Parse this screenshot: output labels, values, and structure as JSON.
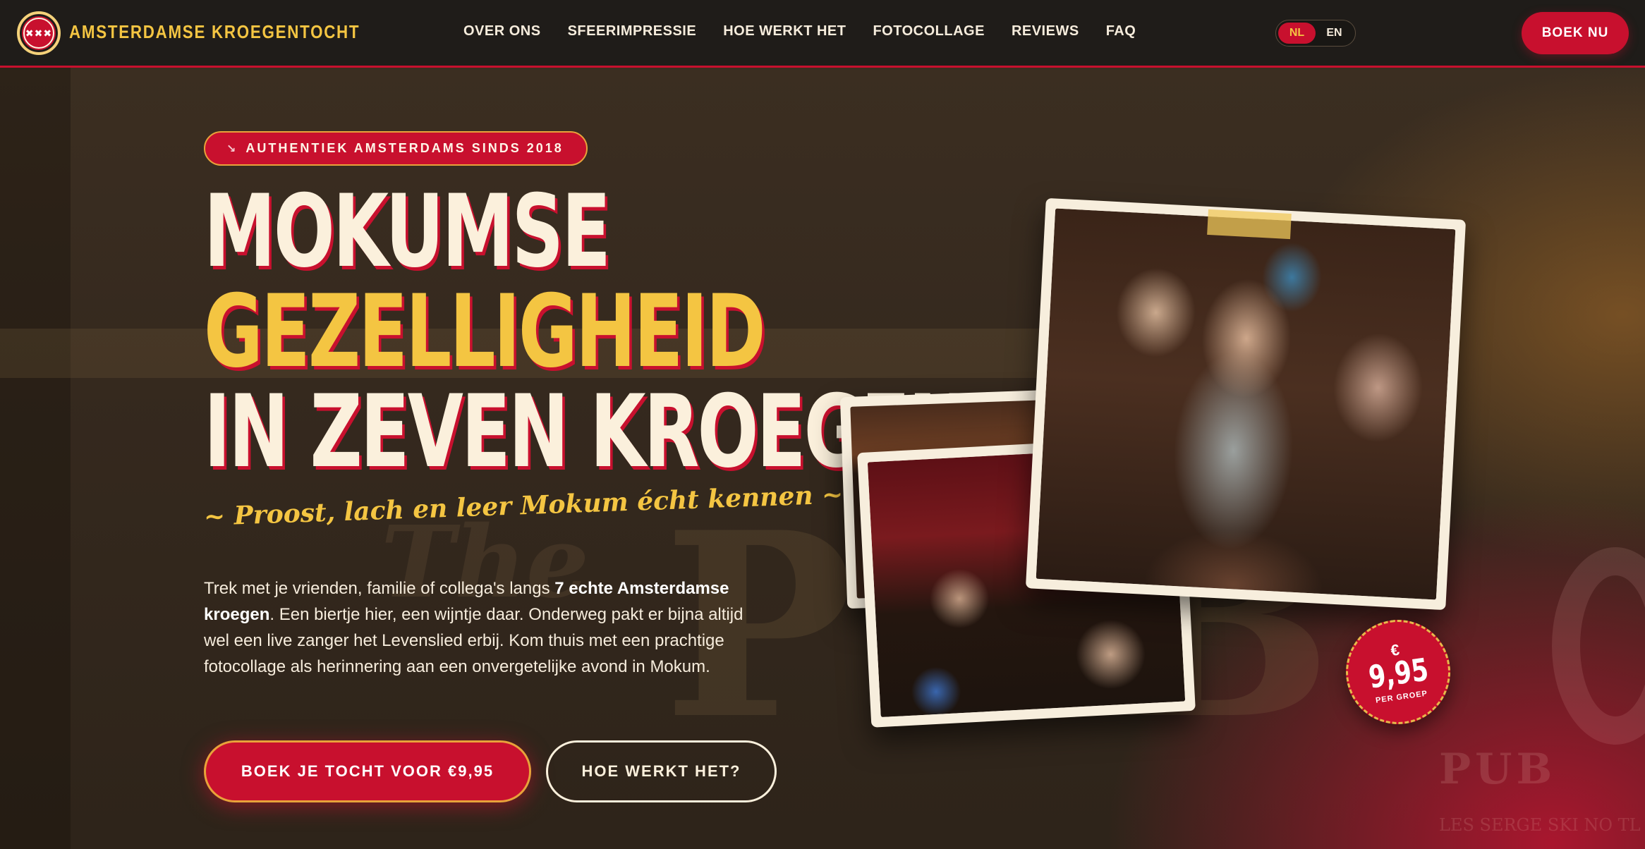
{
  "brand": {
    "logo_mark": "✖✖✖",
    "name": "AMSTERDAMSE KROEGENTOCHT"
  },
  "nav": {
    "items": [
      {
        "label": "OVER ONS"
      },
      {
        "label": "SFEERIMPRESSIE"
      },
      {
        "label": "HOE WERKT HET"
      },
      {
        "label": "FOTOCOLLAGE"
      },
      {
        "label": "REVIEWS"
      },
      {
        "label": "FAQ"
      }
    ],
    "languages": [
      {
        "label": "NL",
        "active": true
      },
      {
        "label": "EN",
        "active": false
      }
    ],
    "cta_label": "BOEK NU"
  },
  "hero": {
    "badge": {
      "icon": "beer-icon",
      "label": "AUTHENTIEK AMSTERDAMS SINDS 2018"
    },
    "headline": {
      "line1": "MOKUMSE",
      "line2": "GEZELLIGHEID",
      "line3": "IN ZEVEN KROEGEN"
    },
    "tagline": "~ Proost, lach en leer Mokum écht kennen ~",
    "intro": {
      "part1": "Trek met je vrienden, familie of collega's langs ",
      "bold1": "7 echte Amsterdamse kroegen",
      "part2": ". Een biertje hier, een wijntje daar. Onderweg pakt er bijna altijd wel een live zanger het Levenslied erbij. Kom thuis met een prachtige fotocollage als herinnering aan een onvergetelijke avond in Mokum."
    },
    "primary_cta": "BOEK JE TOCHT VOOR €9,95",
    "secondary_cta": "HOE WERKT HET?"
  },
  "price_stamp": {
    "currency": "€",
    "amount": "9,95",
    "per": "PER GROEP"
  },
  "background": {
    "sign_text": "PUB",
    "sign_prefix": "The",
    "corner_sign": "PUB",
    "corner_sub": "LES SERGE SKI NO TL"
  },
  "colors": {
    "accent_red": "#c8102e",
    "accent_yellow": "#f4c542",
    "cream": "#fbf0dc",
    "nav_bg": "#1f1c19"
  }
}
